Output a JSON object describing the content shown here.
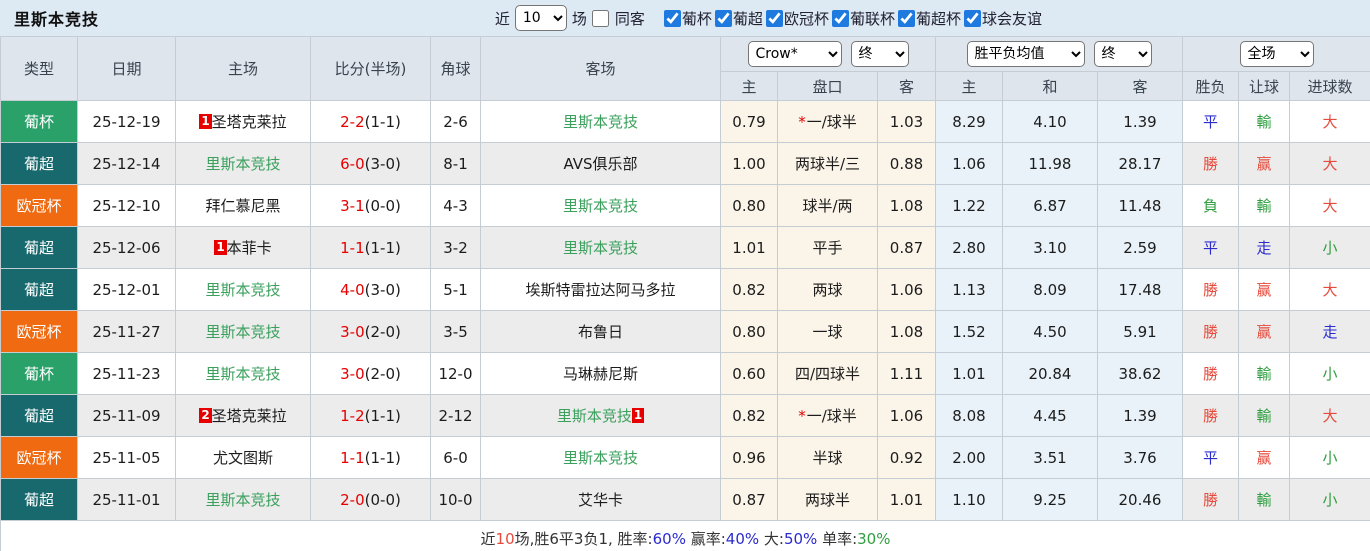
{
  "title": "里斯本竞技",
  "toolbar": {
    "recent_label": "近",
    "recent_value": "10",
    "matches_label": "场",
    "same_away": {
      "label": "同客",
      "checked": false
    },
    "filters": [
      {
        "label": "葡杯",
        "checked": true
      },
      {
        "label": "葡超",
        "checked": true
      },
      {
        "label": "欧冠杯",
        "checked": true
      },
      {
        "label": "葡联杯",
        "checked": true
      },
      {
        "label": "葡超杯",
        "checked": true
      },
      {
        "label": "球会友谊",
        "checked": true
      }
    ]
  },
  "header": {
    "type": "类型",
    "date": "日期",
    "home": "主场",
    "score": "比分(半场)",
    "corner": "角球",
    "away": "客场",
    "odds_company_select": "Crow*",
    "odds_state_select": "终",
    "avg_select": "胜平负均值",
    "avg_state_select": "终",
    "scope_select": "全场",
    "sub": {
      "odds_home": "主",
      "handicap": "盘口",
      "odds_away": "客",
      "avg_home": "主",
      "avg_draw": "和",
      "avg_away": "客",
      "wdl": "胜负",
      "handicap_result": "让球",
      "goals": "进球数"
    }
  },
  "league_colors": {
    "葡杯": "#29a169",
    "葡超": "#17696e",
    "欧冠杯": "#ef6a10"
  },
  "rows": [
    {
      "league": "葡杯",
      "date": "25-12-19",
      "home": {
        "badge": "1",
        "name": "圣塔克莱拉",
        "self": false
      },
      "score": {
        "ft": "2-2",
        "ht": "(1-1)"
      },
      "corner": "2-6",
      "away": {
        "name": "里斯本竞技",
        "self": true
      },
      "odds": [
        "0.79",
        "一/球半",
        "1.03"
      ],
      "odds_star": true,
      "avg": [
        "8.29",
        "4.10",
        "1.39"
      ],
      "results": [
        {
          "t": "平",
          "c": "blue"
        },
        {
          "t": "輸",
          "c": "green"
        },
        {
          "t": "大",
          "c": "red"
        }
      ]
    },
    {
      "league": "葡超",
      "date": "25-12-14",
      "home": {
        "name": "里斯本竞技",
        "self": true
      },
      "score": {
        "ft": "6-0",
        "ht": "(3-0)"
      },
      "corner": "8-1",
      "away": {
        "name": "AVS俱乐部",
        "self": false
      },
      "odds": [
        "1.00",
        "两球半/三",
        "0.88"
      ],
      "odds_star": false,
      "avg": [
        "1.06",
        "11.98",
        "28.17"
      ],
      "results": [
        {
          "t": "勝",
          "c": "red"
        },
        {
          "t": "赢",
          "c": "red"
        },
        {
          "t": "大",
          "c": "red"
        }
      ]
    },
    {
      "league": "欧冠杯",
      "date": "25-12-10",
      "home": {
        "name": "拜仁慕尼黑",
        "self": false
      },
      "score": {
        "ft": "3-1",
        "ht": "(0-0)"
      },
      "corner": "4-3",
      "away": {
        "name": "里斯本竞技",
        "self": true
      },
      "odds": [
        "0.80",
        "球半/两",
        "1.08"
      ],
      "odds_star": false,
      "avg": [
        "1.22",
        "6.87",
        "11.48"
      ],
      "results": [
        {
          "t": "負",
          "c": "green"
        },
        {
          "t": "輸",
          "c": "green"
        },
        {
          "t": "大",
          "c": "red"
        }
      ]
    },
    {
      "league": "葡超",
      "date": "25-12-06",
      "home": {
        "badge": "1",
        "name": "本菲卡",
        "self": false
      },
      "score": {
        "ft": "1-1",
        "ht": "(1-1)"
      },
      "corner": "3-2",
      "away": {
        "name": "里斯本竞技",
        "self": true
      },
      "odds": [
        "1.01",
        "平手",
        "0.87"
      ],
      "odds_star": false,
      "avg": [
        "2.80",
        "3.10",
        "2.59"
      ],
      "results": [
        {
          "t": "平",
          "c": "blue"
        },
        {
          "t": "走",
          "c": "blue"
        },
        {
          "t": "小",
          "c": "green"
        }
      ]
    },
    {
      "league": "葡超",
      "date": "25-12-01",
      "home": {
        "name": "里斯本竞技",
        "self": true
      },
      "score": {
        "ft": "4-0",
        "ht": "(3-0)"
      },
      "corner": "5-1",
      "away": {
        "name": "埃斯特雷拉达阿马多拉",
        "self": false
      },
      "odds": [
        "0.82",
        "两球",
        "1.06"
      ],
      "odds_star": false,
      "avg": [
        "1.13",
        "8.09",
        "17.48"
      ],
      "results": [
        {
          "t": "勝",
          "c": "red"
        },
        {
          "t": "赢",
          "c": "red"
        },
        {
          "t": "大",
          "c": "red"
        }
      ]
    },
    {
      "league": "欧冠杯",
      "date": "25-11-27",
      "home": {
        "name": "里斯本竞技",
        "self": true
      },
      "score": {
        "ft": "3-0",
        "ht": "(2-0)"
      },
      "corner": "3-5",
      "away": {
        "name": "布鲁日",
        "self": false
      },
      "odds": [
        "0.80",
        "一球",
        "1.08"
      ],
      "odds_star": false,
      "avg": [
        "1.52",
        "4.50",
        "5.91"
      ],
      "results": [
        {
          "t": "勝",
          "c": "red"
        },
        {
          "t": "赢",
          "c": "red"
        },
        {
          "t": "走",
          "c": "blue"
        }
      ]
    },
    {
      "league": "葡杯",
      "date": "25-11-23",
      "home": {
        "name": "里斯本竞技",
        "self": true
      },
      "score": {
        "ft": "3-0",
        "ht": "(2-0)"
      },
      "corner": "12-0",
      "away": {
        "name": "马琳赫尼斯",
        "self": false
      },
      "odds": [
        "0.60",
        "四/四球半",
        "1.11"
      ],
      "odds_star": false,
      "avg": [
        "1.01",
        "20.84",
        "38.62"
      ],
      "results": [
        {
          "t": "勝",
          "c": "red"
        },
        {
          "t": "輸",
          "c": "green"
        },
        {
          "t": "小",
          "c": "green"
        }
      ]
    },
    {
      "league": "葡超",
      "date": "25-11-09",
      "home": {
        "badge": "2",
        "name": "圣塔克莱拉",
        "self": false
      },
      "score": {
        "ft": "1-2",
        "ht": "(1-1)"
      },
      "corner": "2-12",
      "away": {
        "name": "里斯本竞技",
        "self": true,
        "badge_after": "1"
      },
      "odds": [
        "0.82",
        "一/球半",
        "1.06"
      ],
      "odds_star": true,
      "avg": [
        "8.08",
        "4.45",
        "1.39"
      ],
      "results": [
        {
          "t": "勝",
          "c": "red"
        },
        {
          "t": "輸",
          "c": "green"
        },
        {
          "t": "大",
          "c": "red"
        }
      ]
    },
    {
      "league": "欧冠杯",
      "date": "25-11-05",
      "home": {
        "name": "尤文图斯",
        "self": false
      },
      "score": {
        "ft": "1-1",
        "ht": "(1-1)"
      },
      "corner": "6-0",
      "away": {
        "name": "里斯本竞技",
        "self": true
      },
      "odds": [
        "0.96",
        "半球",
        "0.92"
      ],
      "odds_star": false,
      "avg": [
        "2.00",
        "3.51",
        "3.76"
      ],
      "results": [
        {
          "t": "平",
          "c": "blue"
        },
        {
          "t": "赢",
          "c": "red"
        },
        {
          "t": "小",
          "c": "green"
        }
      ]
    },
    {
      "league": "葡超",
      "date": "25-11-01",
      "home": {
        "name": "里斯本竞技",
        "self": true
      },
      "score": {
        "ft": "2-0",
        "ht": "(0-0)"
      },
      "corner": "10-0",
      "away": {
        "name": "艾华卡",
        "self": false
      },
      "odds": [
        "0.87",
        "两球半",
        "1.01"
      ],
      "odds_star": false,
      "avg": [
        "1.10",
        "9.25",
        "20.46"
      ],
      "results": [
        {
          "t": "勝",
          "c": "red"
        },
        {
          "t": "輸",
          "c": "green"
        },
        {
          "t": "小",
          "c": "green"
        }
      ]
    }
  ],
  "footer_segments": [
    {
      "t": "近",
      "c": "dark"
    },
    {
      "t": "10",
      "c": "red"
    },
    {
      "t": "场,胜6平3负1, 胜率:",
      "c": "dark"
    },
    {
      "t": "60%",
      "c": "blue"
    },
    {
      "t": " 赢率:",
      "c": "dark"
    },
    {
      "t": "40%",
      "c": "blue"
    },
    {
      "t": " 大:",
      "c": "dark"
    },
    {
      "t": "50%",
      "c": "blue"
    },
    {
      "t": " 单率:",
      "c": "dark"
    },
    {
      "t": "30%",
      "c": "green"
    }
  ]
}
